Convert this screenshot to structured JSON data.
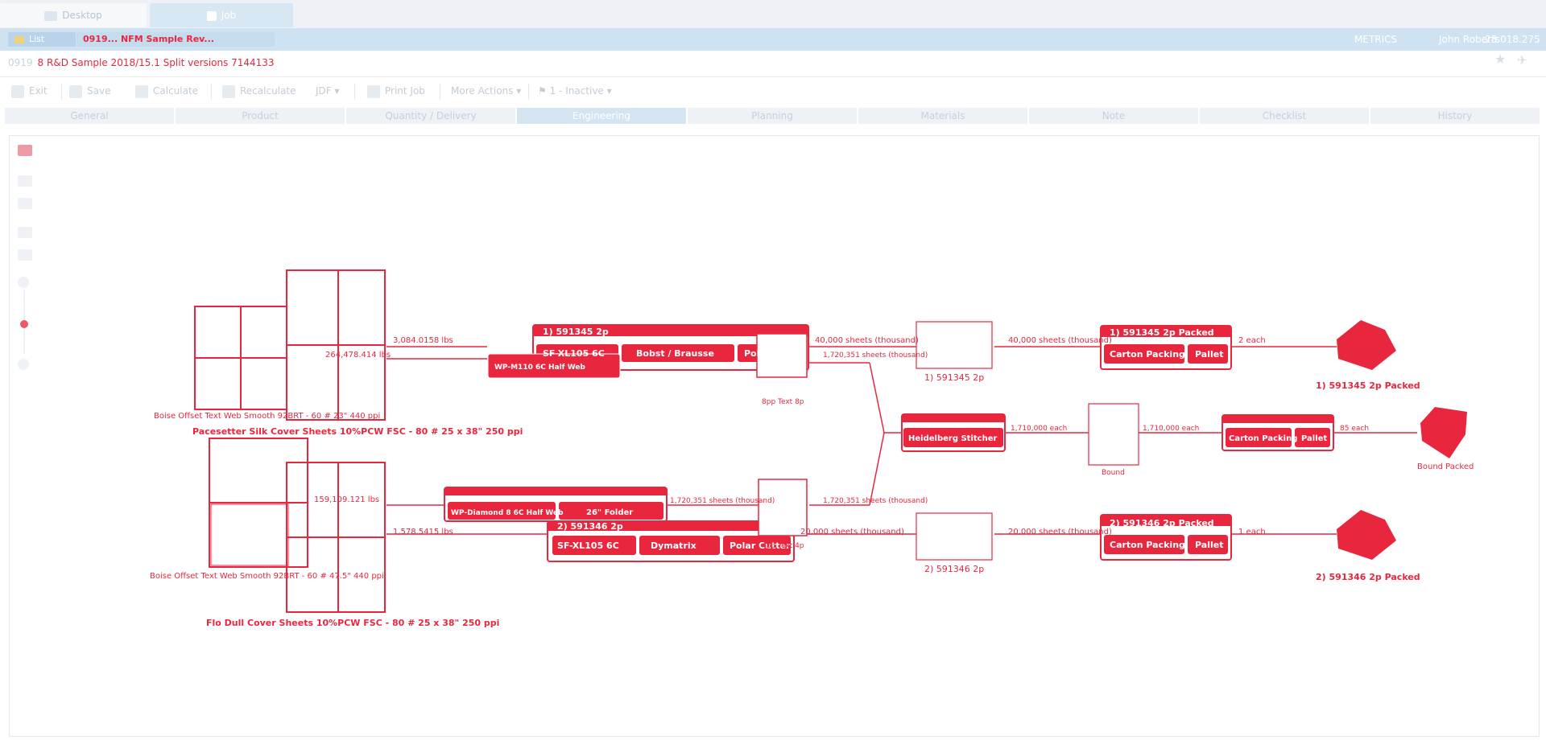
{
  "window_tabs": [
    {
      "label": "Desktop",
      "active": false
    },
    {
      "label": "Job",
      "active": true
    }
  ],
  "header": {
    "list_label": "List",
    "job_pill": "0919...  NFM Sample Rev...",
    "metrics": "METRICS",
    "user": "John Roberts",
    "version": "23.018.275"
  },
  "subtitle": {
    "prefix": "0919",
    "text": "8   R&D Sample 2018/15.1 Split versions 7144133"
  },
  "toolbar": {
    "exit": "Exit",
    "save": "Save",
    "calculate": "Calculate",
    "recalculate": "Recalculate",
    "jdf": "JDF",
    "print_job": "Print Job",
    "more_actions": "More Actions",
    "status": "1 - Inactive"
  },
  "steps": [
    "General",
    "Product",
    "Quantity / Delivery",
    "Engineering",
    "Planning",
    "Materials",
    "Note",
    "Checklist",
    "History"
  ],
  "active_step": "Engineering",
  "colors": {
    "accent": "#e8273f",
    "header_band": "#cfe2f1",
    "active_step": "#d4e4f1"
  },
  "diagram": {
    "paper1": "Pacesetter Silk Cover Sheets 10%PCW FSC - 80 # 25 x 38\" 250 ppi",
    "paper1_text": "Boise Offset Text Web Smooth 92BRT - 60 # 23\" 440 ppi",
    "paper2": "Flo Dull Cover Sheets 10%PCW FSC - 80 # 25 x 38\" 250 ppi",
    "paper2_text": "Boise Offset Text Web Smooth 92BRT - 60 # 47.5\" 440 ppi",
    "qty_a": "3,084.0158 lbs",
    "qty_b": "264,478.414 lbs",
    "qty_c": "1,578.5415 lbs",
    "qty_d": "159,109.121 lbs",
    "proc_group_1": "1) 591345 2p",
    "proc_group_2": "2) 591346 2p",
    "press_1": "SF-XL105 6C",
    "press_2": "SF-XL105 6C",
    "web_1": "WP-M110 6C Half Web",
    "web_2": "WP-Diamond 8 6C Half Web",
    "bobst": "Bobst / Brausse",
    "cutter_1": "Polar Cutter",
    "cutter_2": "Polar Cutter",
    "dymatrix": "Dymatrix",
    "folder": "26\" Folder",
    "text_8p": "8pp Text 8p",
    "text_4p": "4pp Text 4p",
    "sheets_1": "40,000 sheets (thousand)",
    "sheets_1b": "40,000 sheets (thousand)",
    "sheets_2": "20,000 sheets (thousand)",
    "sheets_2b": "20,000 sheets (thousand)",
    "sheets_text": "1,720,351 sheets (thousand)",
    "sheets_text_b": "1,720,351 sheets (thousand)",
    "sheets_text_c": "1,720,351 sheets (thousand)",
    "comp_1": "1) 591345 2p",
    "comp_2": "2) 591346 2p",
    "stitcher": "Heidelberg Stitcher",
    "each_1": "1,710,000 each",
    "each_2": "1,710,000 each",
    "bound": "Bound",
    "pack_group_1": "1) 591345 2p Packed",
    "pack_group_2": "2) 591346 2p Packed",
    "carton": "Carton Packing",
    "pallet": "Pallet",
    "out_1_qty": "2 each",
    "out_2_qty": "1 each",
    "bound_qty": "85 each",
    "out_1": "1) 591345 2p Packed",
    "out_2": "2) 591346 2p Packed",
    "bound_out": "Bound Packed"
  }
}
